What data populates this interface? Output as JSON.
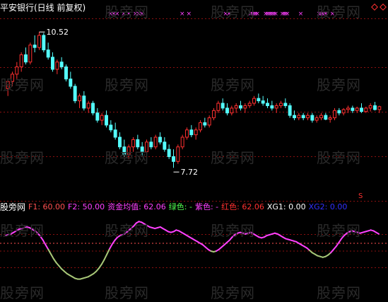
{
  "header": {
    "title": "平安银行(日线 前复权)"
  },
  "watermark": "股旁网",
  "chart_data": [
    {
      "type": "candlestick",
      "title": "平安银行(日线 前复权)",
      "ylim": [
        7.3,
        10.8
      ],
      "annotations": {
        "high": "10.52",
        "low": "7.72"
      },
      "up_color": "#ff3030",
      "down_color": "#54ffff",
      "candles": [
        [
          9.35,
          9.55,
          9.2,
          9.5
        ],
        [
          9.5,
          9.7,
          9.4,
          9.65
        ],
        [
          9.65,
          9.9,
          9.55,
          9.8
        ],
        [
          9.8,
          10.1,
          9.7,
          10.05
        ],
        [
          10.05,
          10.2,
          9.85,
          9.9
        ],
        [
          9.9,
          10.3,
          9.85,
          10.25
        ],
        [
          10.25,
          10.45,
          10.1,
          10.2
        ],
        [
          10.2,
          10.52,
          10.15,
          10.45
        ],
        [
          10.45,
          10.5,
          10.1,
          10.15
        ],
        [
          10.15,
          10.3,
          9.95,
          10.0
        ],
        [
          10.0,
          10.1,
          9.7,
          9.75
        ],
        [
          9.75,
          9.95,
          9.65,
          9.9
        ],
        [
          9.9,
          10.0,
          9.75,
          9.8
        ],
        [
          9.8,
          9.85,
          9.5,
          9.55
        ],
        [
          9.55,
          9.7,
          9.35,
          9.4
        ],
        [
          9.4,
          9.45,
          9.05,
          9.1
        ],
        [
          9.1,
          9.25,
          8.95,
          9.2
        ],
        [
          9.2,
          9.3,
          8.9,
          8.95
        ],
        [
          8.95,
          9.1,
          8.85,
          9.05
        ],
        [
          9.05,
          9.1,
          8.8,
          8.85
        ],
        [
          8.85,
          8.95,
          8.65,
          8.7
        ],
        [
          8.7,
          8.85,
          8.6,
          8.8
        ],
        [
          8.8,
          8.9,
          8.55,
          8.6
        ],
        [
          8.6,
          8.7,
          8.45,
          8.5
        ],
        [
          8.5,
          8.65,
          8.3,
          8.35
        ],
        [
          8.35,
          8.45,
          8.1,
          8.15
        ],
        [
          8.15,
          8.3,
          7.95,
          8.0
        ],
        [
          8.0,
          8.2,
          7.9,
          8.15
        ],
        [
          8.15,
          8.35,
          8.05,
          8.3
        ],
        [
          8.3,
          8.4,
          8.1,
          8.15
        ],
        [
          8.15,
          8.25,
          7.95,
          8.05
        ],
        [
          8.05,
          8.3,
          8.0,
          8.25
        ],
        [
          8.25,
          8.35,
          8.1,
          8.15
        ],
        [
          8.15,
          8.4,
          8.1,
          8.35
        ],
        [
          8.35,
          8.45,
          8.2,
          8.25
        ],
        [
          8.25,
          8.35,
          8.05,
          8.1
        ],
        [
          8.1,
          8.2,
          7.9,
          7.95
        ],
        [
          7.95,
          8.1,
          7.72,
          7.85
        ],
        [
          7.85,
          8.2,
          7.8,
          8.15
        ],
        [
          8.15,
          8.4,
          8.1,
          8.35
        ],
        [
          8.35,
          8.55,
          8.3,
          8.5
        ],
        [
          8.5,
          8.6,
          8.35,
          8.4
        ],
        [
          8.4,
          8.55,
          8.3,
          8.5
        ],
        [
          8.5,
          8.7,
          8.45,
          8.65
        ],
        [
          8.65,
          8.75,
          8.55,
          8.6
        ],
        [
          8.6,
          8.8,
          8.55,
          8.75
        ],
        [
          8.75,
          8.95,
          8.7,
          8.9
        ],
        [
          8.9,
          9.1,
          8.85,
          9.05
        ],
        [
          9.05,
          9.15,
          8.9,
          8.95
        ],
        [
          8.95,
          9.05,
          8.8,
          8.85
        ],
        [
          8.85,
          9.0,
          8.8,
          8.95
        ],
        [
          8.95,
          9.05,
          8.85,
          9.0
        ],
        [
          9.0,
          9.1,
          8.9,
          8.95
        ],
        [
          8.95,
          9.05,
          8.85,
          9.0
        ],
        [
          9.0,
          9.1,
          8.95,
          9.05
        ],
        [
          9.05,
          9.2,
          9.0,
          9.15
        ],
        [
          9.15,
          9.25,
          9.05,
          9.1
        ],
        [
          9.1,
          9.2,
          9.0,
          9.05
        ],
        [
          9.05,
          9.15,
          8.95,
          9.0
        ],
        [
          9.0,
          9.1,
          8.9,
          8.95
        ],
        [
          8.95,
          9.05,
          8.85,
          9.0
        ],
        [
          9.0,
          9.1,
          8.95,
          9.05
        ],
        [
          9.05,
          9.15,
          8.95,
          9.0
        ],
        [
          9.0,
          9.05,
          8.75,
          8.8
        ],
        [
          8.8,
          8.9,
          8.7,
          8.75
        ],
        [
          8.75,
          8.85,
          8.7,
          8.8
        ],
        [
          8.8,
          8.85,
          8.7,
          8.75
        ],
        [
          8.75,
          8.85,
          8.7,
          8.8
        ],
        [
          8.8,
          8.85,
          8.65,
          8.7
        ],
        [
          8.7,
          8.8,
          8.65,
          8.75
        ],
        [
          8.75,
          8.85,
          8.7,
          8.8
        ],
        [
          8.8,
          8.85,
          8.7,
          8.72
        ],
        [
          8.72,
          8.8,
          8.65,
          8.75
        ],
        [
          8.75,
          8.95,
          8.7,
          8.9
        ],
        [
          8.9,
          8.95,
          8.8,
          8.85
        ],
        [
          8.85,
          8.95,
          8.8,
          8.92
        ],
        [
          8.92,
          9.0,
          8.85,
          8.95
        ],
        [
          8.95,
          9.0,
          8.85,
          8.9
        ],
        [
          8.9,
          8.98,
          8.85,
          8.95
        ],
        [
          8.95,
          9.05,
          8.85,
          8.88
        ],
        [
          8.88,
          8.98,
          8.85,
          8.95
        ],
        [
          8.95,
          9.05,
          8.88,
          9.0
        ],
        [
          9.0,
          9.08,
          8.9,
          8.92
        ],
        [
          8.92,
          9.0,
          8.85,
          8.98
        ]
      ]
    },
    {
      "type": "line",
      "title": "资金均值",
      "ylim": [
        0,
        100
      ],
      "ref_lines": [
        {
          "name": "F1",
          "value": 60.0
        },
        {
          "name": "F2",
          "value": 50.0
        }
      ],
      "series": [
        {
          "name": "资金均值",
          "last": "62.06",
          "values": [
            70,
            71,
            72,
            74,
            76,
            78,
            79,
            80,
            81,
            80,
            78,
            76,
            73,
            69,
            64,
            58,
            52,
            46,
            40,
            35,
            31,
            27,
            24,
            21,
            19,
            17,
            15,
            14,
            14,
            15,
            16,
            17,
            19,
            21,
            24,
            28,
            33,
            39,
            46,
            53,
            59,
            64,
            68,
            70,
            71,
            73,
            76,
            79,
            82,
            86,
            88,
            87,
            85,
            83,
            81,
            80,
            79,
            80,
            81,
            79,
            77,
            75,
            74,
            75,
            77,
            76,
            74,
            72,
            70,
            68,
            66,
            64,
            62,
            60,
            58,
            55,
            52,
            50,
            49,
            50,
            52,
            55,
            58,
            61,
            64,
            68,
            71,
            73,
            74,
            73,
            72,
            73,
            74,
            72,
            70,
            68,
            67,
            68,
            70,
            71,
            72,
            73,
            72,
            70,
            68,
            66,
            65,
            64,
            63,
            62,
            60,
            58,
            56,
            54,
            51,
            48,
            46,
            44,
            43,
            42,
            43,
            45,
            48,
            52,
            56,
            61,
            66,
            70,
            73,
            75,
            76,
            75,
            74,
            73,
            74,
            75,
            76,
            77,
            76,
            74,
            72
          ]
        }
      ],
      "color_rule": {
        "above": "#ff40ff",
        "below": "#a8c878",
        "threshold": 50
      }
    }
  ],
  "legend": {
    "name": "股旁网",
    "f1": "F1: 60.00",
    "f2": "F2: 50.00",
    "zj": "资金均值: 62.06",
    "green": "绿色: -",
    "purple": "紫色: -",
    "red": "红色: 62.06",
    "xg1": "XG1: 0.00",
    "xg2": "XG2: 0.00"
  },
  "colors": {
    "f1": "#ff5050",
    "f2": "#ff40ff",
    "zj": "#ff40ff",
    "green": "#50ff50",
    "purple": "#ff40ff",
    "red": "#ff3030",
    "xg1": "#ffffff",
    "xg2": "#3030ff",
    "grid": "#8b1010",
    "signal": "#ff40ff",
    "marker_small": "#ff3030"
  },
  "signals": {
    "marker": "×",
    "positions": [
      1,
      3,
      5,
      9,
      12,
      16,
      18,
      20,
      44,
      48,
      70,
      72,
      85,
      86,
      87,
      88,
      89,
      94,
      95,
      96,
      97,
      98,
      99,
      100,
      104,
      105,
      106,
      107,
      115,
      126,
      127,
      128,
      129,
      130,
      134
    ]
  }
}
